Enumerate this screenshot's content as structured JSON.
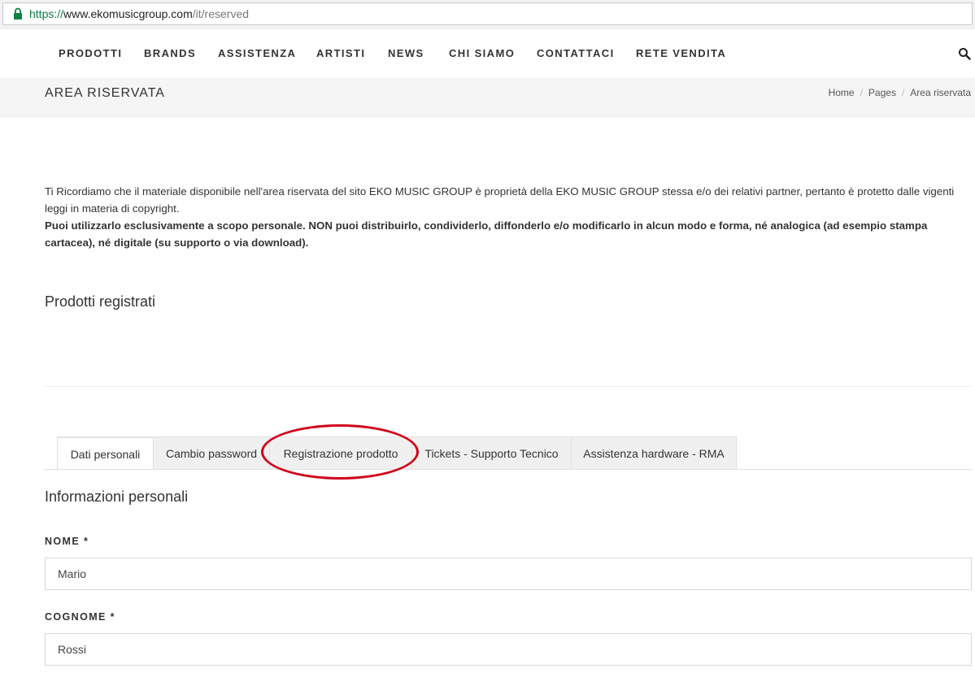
{
  "browser": {
    "url_scheme": "https://",
    "url_host": "www.ekomusicgroup.com",
    "url_path": "/it/reserved"
  },
  "nav": {
    "items": [
      "PRODOTTI",
      "BRANDS",
      "ASSISTENZA",
      "ARTISTI",
      "NEWS",
      "CHI SIAMO",
      "CONTATTACI",
      "RETE VENDITA"
    ],
    "search_icon": "search-icon"
  },
  "titlebar": {
    "title": "AREA RISERVATA",
    "breadcrumb": [
      "Home",
      "Pages",
      "Area riservata"
    ]
  },
  "notice": {
    "text": "Ti Ricordiamo che il materiale disponibile nell'area riservata del sito EKO MUSIC GROUP è proprietà della EKO MUSIC GROUP stessa e/o dei relativi partner, pertanto è protetto dalle vigenti leggi in materia di copyright.",
    "bold_text": "Puoi utilizzarlo esclusivamente a scopo personale. NON puoi distribuirlo, condividerlo, diffonderlo e/o modificarlo in alcun modo e forma, né analogica (ad esempio stampa cartacea), né digitale (su supporto o via download)."
  },
  "registered_products": {
    "title": "Prodotti registrati"
  },
  "tabs": {
    "items": [
      "Dati personali",
      "Cambio password",
      "Registrazione prodotto",
      "Tickets - Supporto Tecnico",
      "Assistenza hardware - RMA"
    ],
    "active": "Dati personali",
    "highlighted": "Registrazione prodotto",
    "highlight_color": "#d0021b"
  },
  "form": {
    "title": "Informazioni personali",
    "nome_label": "NOME *",
    "nome_value": "Mario",
    "cognome_label": "COGNOME *",
    "cognome_value": "Rossi"
  },
  "colors": {
    "lock_green": "#0b8043",
    "titlebar_bg": "#f5f5f5"
  }
}
